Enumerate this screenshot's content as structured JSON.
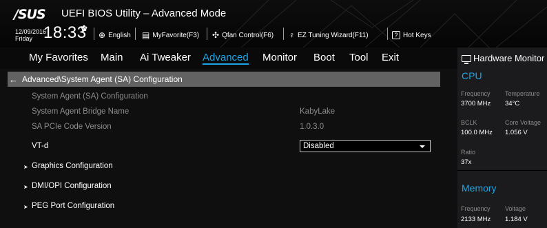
{
  "header": {
    "logo": "/SUS",
    "title": "UEFI BIOS Utility – Advanced Mode",
    "date": "12/09/2016",
    "day": "Friday",
    "time": "18:33",
    "toolbar": [
      {
        "icon": "globe-icon",
        "label": "English"
      },
      {
        "icon": "my-favorite-icon",
        "label": "MyFavorite(F3)"
      },
      {
        "icon": "fan-icon",
        "label": "Qfan Control(F6)"
      },
      {
        "icon": "bulb-icon",
        "label": "EZ Tuning Wizard(F11)"
      },
      {
        "icon": "help-box-icon",
        "label": "Hot Keys"
      }
    ]
  },
  "menu": {
    "items": [
      "My Favorites",
      "Main",
      "Ai Tweaker",
      "Advanced",
      "Monitor",
      "Boot",
      "Tool",
      "Exit"
    ],
    "active": "Advanced"
  },
  "content": {
    "breadcrumb": "Advanced\\System Agent (SA) Configuration",
    "rows": [
      {
        "label": "System Agent (SA) Configuration",
        "value": ""
      },
      {
        "label": "System Agent Bridge Name",
        "value": "KabyLake"
      },
      {
        "label": "SA PCIe Code Version",
        "value": "1.0.3.0"
      }
    ],
    "vtd": {
      "label": "VT-d",
      "value": "Disabled"
    },
    "submenus": [
      "Graphics Configuration",
      "DMI/OPI Configuration",
      "PEG Port Configuration"
    ]
  },
  "hardware_monitor": {
    "title": "Hardware Monitor",
    "cpu": {
      "section": "CPU",
      "frequency_label": "Frequency",
      "frequency": "3700 MHz",
      "temperature_label": "Temperature",
      "temperature": "34°C",
      "bclk_label": "BCLK",
      "bclk": "100.0 MHz",
      "core_voltage_label": "Core Voltage",
      "core_voltage": "1.056 V",
      "ratio_label": "Ratio",
      "ratio": "37x"
    },
    "memory": {
      "section": "Memory",
      "frequency_label": "Frequency",
      "frequency": "2133 MHz",
      "voltage_label": "Voltage",
      "voltage": "1.184 V"
    }
  },
  "colors": {
    "accent": "#1ea7e6",
    "breadcrumb_bg": "#626262",
    "dim_text": "#8c8c8c"
  }
}
